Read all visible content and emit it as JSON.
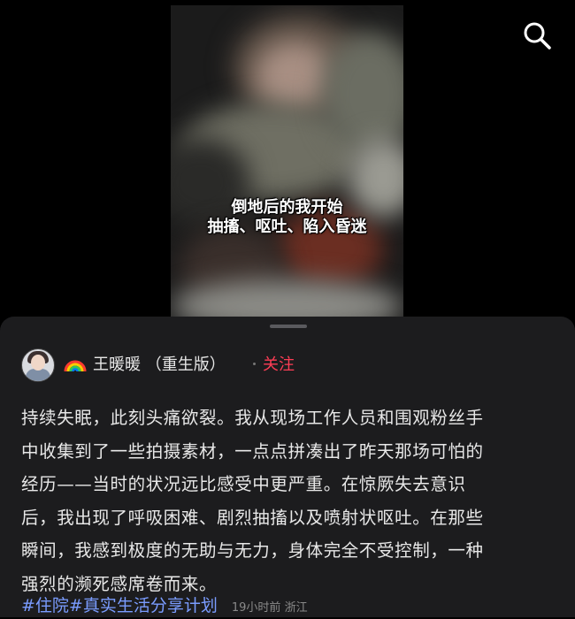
{
  "video": {
    "caption_line1": "倒地后的我开始",
    "caption_line2": "抽搐、呕吐、陷入昏迷"
  },
  "toolbar": {
    "search_icon": "search-icon"
  },
  "post": {
    "author": {
      "emoji_icon": "rainbow-icon",
      "name": "王暖暖 （重生版）"
    },
    "follow_label": "关注",
    "lines": [
      "持续失眠，此刻头痛欲裂。我从现场工作人员和围观粉丝手",
      "中收集到了一些拍摄素材，一点点拼凑出了昨天那场可怕的",
      "经历——当时的状况远比感受中更严重。在惊厥失去意识",
      "后，我出现了呼吸困难、剧烈抽搐以及喷射状呕吐。在那些",
      "瞬间，我感到极度的无助与无力，身体完全不受控制，一种",
      "强烈的濒死感席卷而来。"
    ],
    "tags": "#住院#真实生活分享计划",
    "meta": "19小时前 浙江"
  },
  "colors": {
    "follow": "#ff3d55",
    "tag": "#7a9cff",
    "sheet": "#1c1c1e"
  }
}
